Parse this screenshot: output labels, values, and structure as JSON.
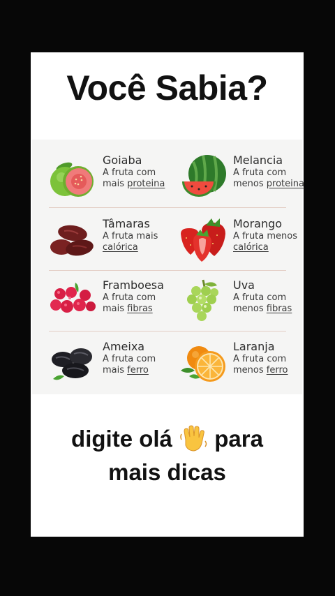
{
  "title": "Você Sabia?",
  "fruits": [
    {
      "name": "Goiaba",
      "desc1": "A fruta com",
      "desc2a": "mais ",
      "desc2b": "proteina",
      "icon": "guava-icon"
    },
    {
      "name": "Melancia",
      "desc1": "A fruta com",
      "desc2a": "menos ",
      "desc2b": "proteina",
      "icon": "watermelon-icon"
    },
    {
      "name": "Tâmaras",
      "desc1": "A fruta mais",
      "desc2a": "",
      "desc2b": "calórica",
      "icon": "dates-icon"
    },
    {
      "name": "Morango",
      "desc1": "A fruta menos",
      "desc2a": "",
      "desc2b": "calórica",
      "icon": "strawberry-icon"
    },
    {
      "name": "Framboesa",
      "desc1": "A fruta com",
      "desc2a": "mais ",
      "desc2b": "fibras",
      "icon": "raspberry-icon"
    },
    {
      "name": "Uva",
      "desc1": "A fruta com",
      "desc2a": "menos ",
      "desc2b": "fibras",
      "icon": "grapes-icon"
    },
    {
      "name": "Ameixa",
      "desc1": "A fruta com",
      "desc2a": "mais ",
      "desc2b": "ferro",
      "icon": "prunes-icon"
    },
    {
      "name": "Laranja",
      "desc1": "A fruta com",
      "desc2a": "menos ",
      "desc2b": "ferro",
      "icon": "orange-icon"
    }
  ],
  "cta": {
    "line1_before": "digite olá",
    "line1_after": "para",
    "line2": "mais dicas",
    "emoji": "waving-hand-icon"
  },
  "colors": {
    "background": "#070707",
    "card": "#ffffff",
    "panel": "#f5f5f4",
    "divider": "#e3cdc4"
  }
}
